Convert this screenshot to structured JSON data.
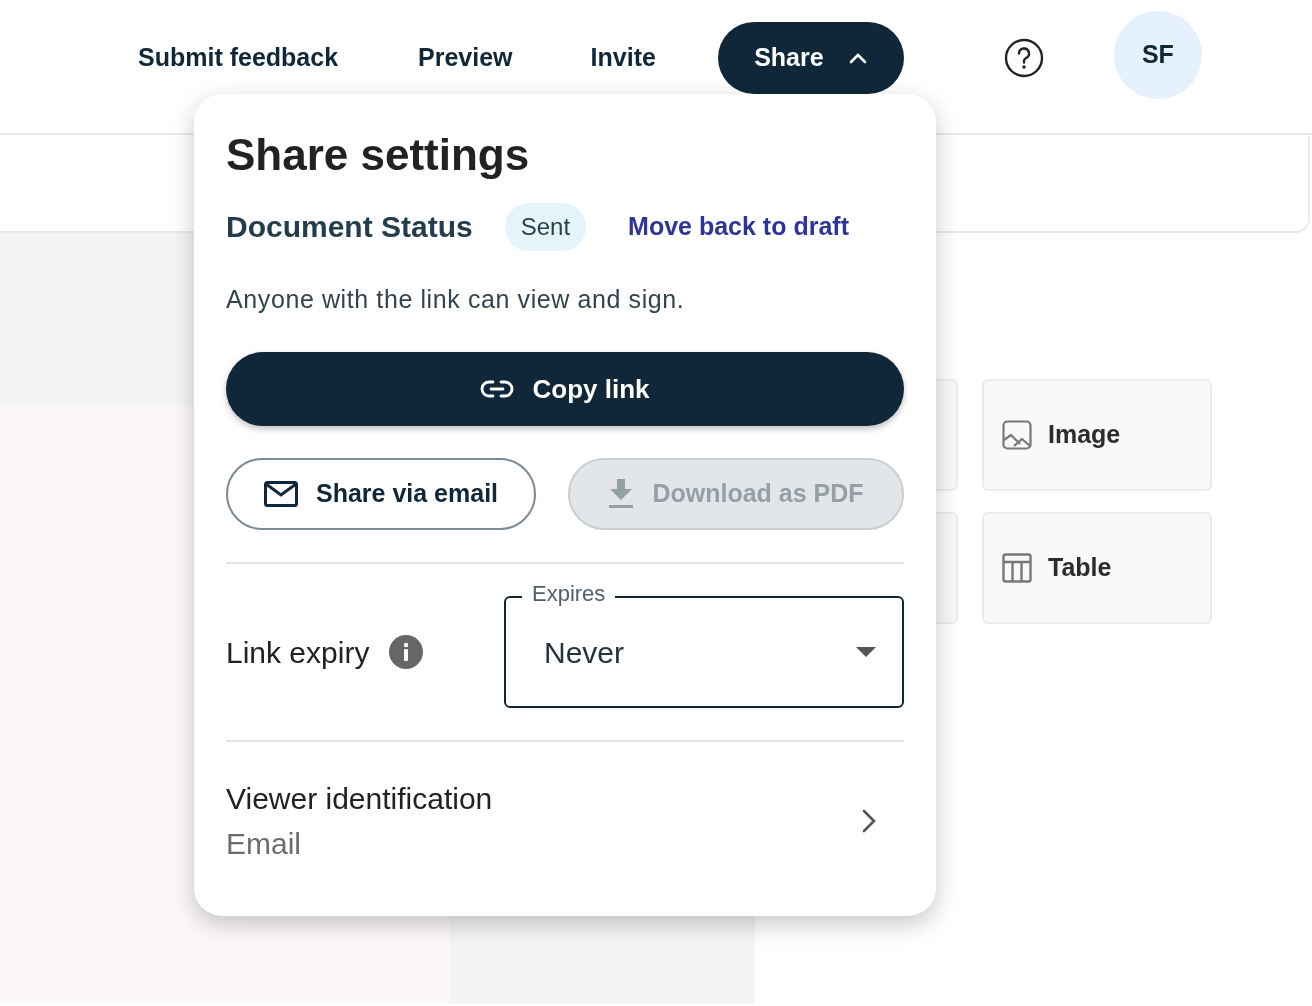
{
  "header": {
    "links": [
      "Submit feedback",
      "Preview",
      "Invite"
    ],
    "share_button": {
      "label": "Share",
      "expanded": true
    },
    "avatar": "SF"
  },
  "tiles": [
    {
      "kind": "hidden"
    },
    {
      "kind": "image",
      "label": "Image"
    },
    {
      "kind": "hidden"
    },
    {
      "kind": "table",
      "label": "Table"
    }
  ],
  "share_popup": {
    "title": "Share settings",
    "status_label": "Document Status",
    "status": "Sent",
    "status_action": "Move back to draft",
    "description": "Anyone with the link can view and sign.",
    "copy_button": "Copy link",
    "buttons": [
      {
        "kind": "email",
        "label": "Share via email",
        "disabled": false
      },
      {
        "kind": "download",
        "label": "Download as PDF",
        "disabled": true
      }
    ],
    "expiry": {
      "label": "Link expiry",
      "field_label": "Expires",
      "value": "Never"
    },
    "viewer": {
      "title": "Viewer identification",
      "value": "Email"
    }
  }
}
